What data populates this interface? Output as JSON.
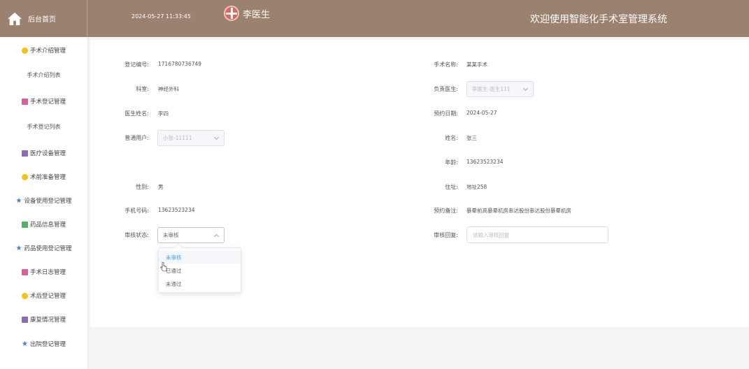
{
  "header": {
    "home_label": "后台首页",
    "datetime": "2024-05-27 11:33:45",
    "user_name": "李医生",
    "welcome": "欢迎使用智能化手术室管理系统",
    "bg_color": "#9b8170"
  },
  "sidebar": {
    "items": [
      {
        "label": "手术介绍管理",
        "icon": "yellow-dot-icon"
      },
      {
        "label": "手术介绍列表",
        "sub": true
      },
      {
        "label": "手术登记管理",
        "icon": "pink-square-icon"
      },
      {
        "label": "手术登记列表",
        "sub": true
      },
      {
        "label": "医疗设备管理",
        "icon": "purple-square-icon"
      },
      {
        "label": "术前准备管理",
        "icon": "yellow-dot-icon"
      },
      {
        "label": "设备使用登记管理",
        "icon": "blue-star-icon"
      },
      {
        "label": "药品信息管理",
        "icon": "green-square-icon"
      },
      {
        "label": "药品使用登记管理",
        "icon": "blue-star-icon"
      },
      {
        "label": "手术日志管理",
        "icon": "pink-square-icon"
      },
      {
        "label": "术后登记管理",
        "icon": "yellow-dot-icon"
      },
      {
        "label": "康复情况管理",
        "icon": "purple-square-icon"
      },
      {
        "label": "出院登记管理",
        "icon": "blue-star-icon"
      }
    ]
  },
  "form": {
    "reg_no_label": "登记编号:",
    "reg_no": "1716780736749",
    "surgery_name_label": "手术名称:",
    "surgery_name": "某某手术",
    "dept_label": "科室:",
    "dept": "神经外科",
    "doctor_label": "负责医生:",
    "doctor_value": "李医生-医生111",
    "doctor_name_label": "医生姓名:",
    "doctor_name": "李四",
    "appt_date_label": "预约日期:",
    "appt_date": "2024-05-27",
    "user_label": "普通用户:",
    "user_value": "小张-11111",
    "name_label": "姓名:",
    "name": "张三",
    "age_label": "年龄:",
    "age": "13623523234",
    "gender_label": "性别:",
    "gender": "男",
    "address_label": "住址:",
    "address": "地址258",
    "phone_label": "手机号码:",
    "phone": "13623523234",
    "appt_note_label": "预约备注:",
    "appt_note": "暴晕前高暴晕机房串达股份串达股份暴晕机房",
    "audit_status_label": "审核状态:",
    "audit_status": "未审核",
    "audit_reply_label": "审核回复:",
    "audit_reply_placeholder": "请输入审核回复"
  },
  "dropdown": {
    "options": [
      "未审核",
      "已通过",
      "未通过"
    ]
  }
}
